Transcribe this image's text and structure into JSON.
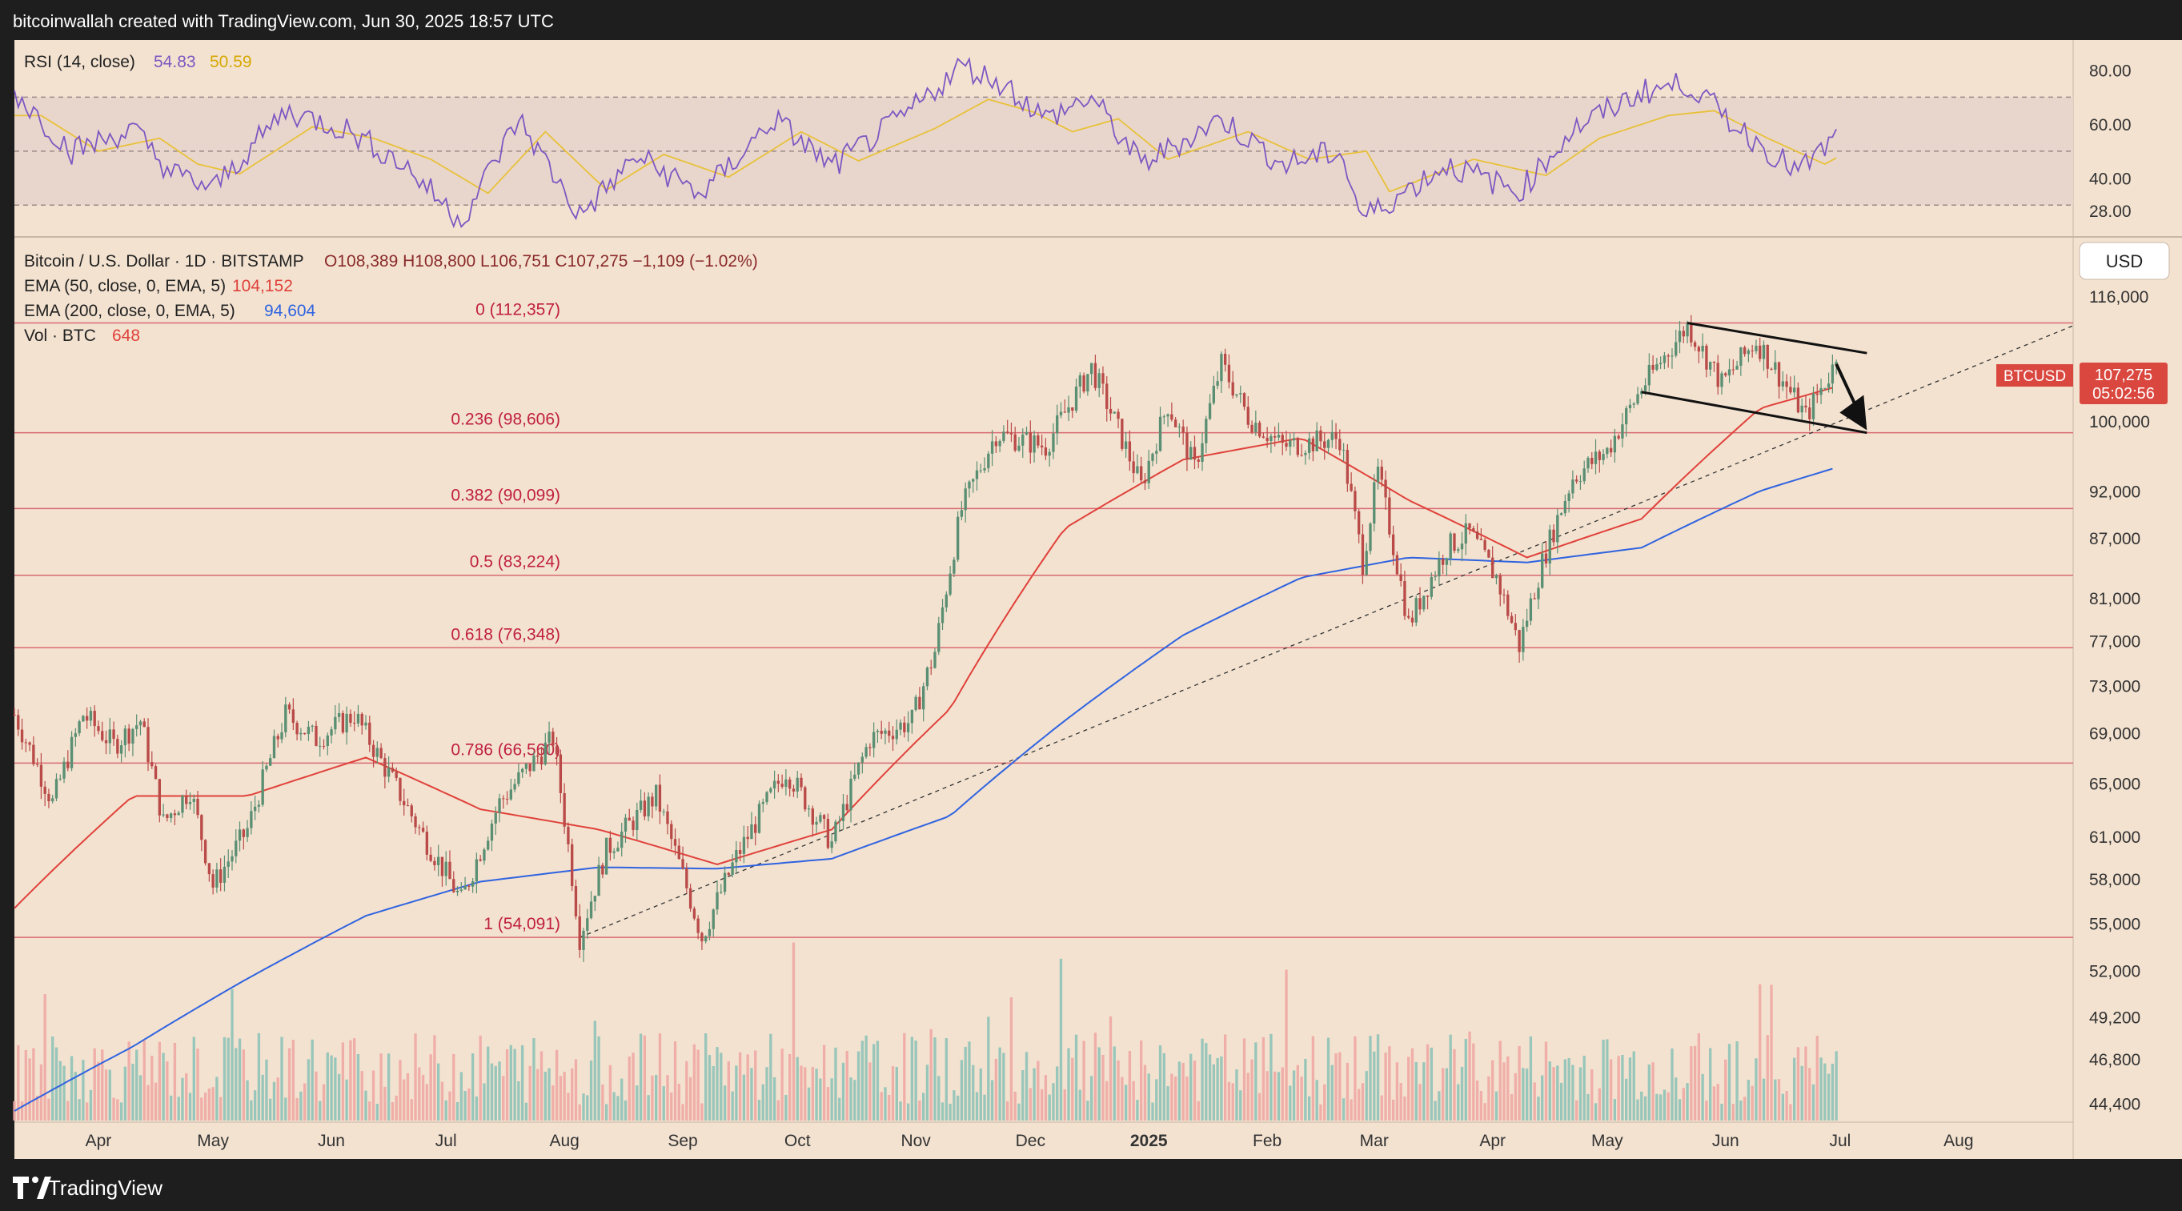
{
  "header": {
    "attribution": "bitcoinwallah created with TradingView.com, Jun 30, 2025 18:57 UTC"
  },
  "footer": {
    "brand": "TradingView"
  },
  "colors": {
    "page_bg": "#1e1e1e",
    "panel_bg": "#f3e2d0",
    "rsi_band": "#e8d6cc",
    "up_candle": "#5a8f73",
    "down_candle": "#b94a48",
    "rsi_line": "#7e57c2",
    "rsi_ma": "#e8c13a",
    "ema50": "#e0413a",
    "ema200": "#2f63e0",
    "fib_line": "#d96a72",
    "fib_text": "#c02040",
    "vol_up": "#8fc3b7",
    "vol_down": "#f0a8a3",
    "price_tag": "#d9473f"
  },
  "rsi_panel": {
    "title": "RSI (14, close)",
    "value": "54.83",
    "ma_value": "50.59",
    "ticks": [
      "80.00",
      "60.00",
      "40.00",
      "28.00"
    ]
  },
  "legend": {
    "symbol": "Bitcoin / U.S. Dollar · 1D · BITSTAMP",
    "ohlc": "O108,389  H108,800  L106,751  C107,275  −1,109 (−1.02%)",
    "ema50_label": "EMA (50, close, 0, EMA, 5)",
    "ema50_value": "104,152",
    "ema200_label": "EMA (200, close, 0, EMA, 5)",
    "ema200_value": "94,604",
    "vol_label": "Vol · BTC",
    "vol_value": "648"
  },
  "currency_button": "USD",
  "price_tag": {
    "symbol": "BTCUSD",
    "price": "107,275",
    "countdown": "05:02:56"
  },
  "price_axis_ticks": [
    {
      "label": "116,000",
      "value": 116000
    },
    {
      "label": "100,000",
      "value": 100000
    },
    {
      "label": "92,000",
      "value": 92000
    },
    {
      "label": "87,000",
      "value": 87000
    },
    {
      "label": "81,000",
      "value": 81000
    },
    {
      "label": "77,000",
      "value": 77000
    },
    {
      "label": "73,000",
      "value": 73000
    },
    {
      "label": "69,000",
      "value": 69000
    },
    {
      "label": "65,000",
      "value": 65000
    },
    {
      "label": "61,000",
      "value": 61000
    },
    {
      "label": "58,000",
      "value": 58000
    },
    {
      "label": "55,000",
      "value": 55000
    },
    {
      "label": "52,000",
      "value": 52000
    },
    {
      "label": "49,200",
      "value": 49200
    },
    {
      "label": "46,800",
      "value": 46800
    },
    {
      "label": "44,400",
      "value": 44400
    }
  ],
  "time_axis": [
    {
      "label": "Apr",
      "date": "2024-04-01",
      "bold": false
    },
    {
      "label": "May",
      "date": "2024-05-01",
      "bold": false
    },
    {
      "label": "Jun",
      "date": "2024-06-01",
      "bold": false
    },
    {
      "label": "Jul",
      "date": "2024-07-01",
      "bold": false
    },
    {
      "label": "Aug",
      "date": "2024-08-01",
      "bold": false
    },
    {
      "label": "Sep",
      "date": "2024-09-01",
      "bold": false
    },
    {
      "label": "Oct",
      "date": "2024-10-01",
      "bold": false
    },
    {
      "label": "Nov",
      "date": "2024-11-01",
      "bold": false
    },
    {
      "label": "Dec",
      "date": "2024-12-01",
      "bold": false
    },
    {
      "label": "2025",
      "date": "2025-01-01",
      "bold": true
    },
    {
      "label": "Feb",
      "date": "2025-02-01",
      "bold": false
    },
    {
      "label": "Mar",
      "date": "2025-03-01",
      "bold": false
    },
    {
      "label": "Apr",
      "date": "2025-04-01",
      "bold": false
    },
    {
      "label": "May",
      "date": "2025-05-01",
      "bold": false
    },
    {
      "label": "Jun",
      "date": "2025-06-01",
      "bold": false
    },
    {
      "label": "Jul",
      "date": "2025-07-01",
      "bold": false
    },
    {
      "label": "Aug",
      "date": "2025-08-01",
      "bold": false
    }
  ],
  "chart_data": {
    "type": "line",
    "title": "Bitcoin / U.S. Dollar · 1D · BITSTAMP",
    "y_scale": "log",
    "ylim": [
      43500,
      124000
    ],
    "x_range": [
      "2024-03-10",
      "2025-08-31"
    ],
    "grid": false,
    "fib_levels": [
      {
        "label": "0 (112,357)",
        "value": 112357
      },
      {
        "label": "0.236 (98,606)",
        "value": 98606
      },
      {
        "label": "0.382 (90,099)",
        "value": 90099
      },
      {
        "label": "0.5 (83,224)",
        "value": 83224
      },
      {
        "label": "0.618 (76,348)",
        "value": 76348
      },
      {
        "label": "0.786 (66,560)",
        "value": 66560
      },
      {
        "label": "1 (54,091)",
        "value": 54091
      }
    ],
    "series": [
      {
        "name": "Bitcoin / U.S. Dollar",
        "points": [
          [
            "2024-03-10",
            70500
          ],
          [
            "2024-03-20",
            63500
          ],
          [
            "2024-03-28",
            70500
          ],
          [
            "2024-04-05",
            68000
          ],
          [
            "2024-04-12",
            70000
          ],
          [
            "2024-04-18",
            62000
          ],
          [
            "2024-04-25",
            64500
          ],
          [
            "2024-05-01",
            57500
          ],
          [
            "2024-05-10",
            61500
          ],
          [
            "2024-05-20",
            70500
          ],
          [
            "2024-05-28",
            68500
          ],
          [
            "2024-06-07",
            70500
          ],
          [
            "2024-06-15",
            66200
          ],
          [
            "2024-06-24",
            61500
          ],
          [
            "2024-07-05",
            56500
          ],
          [
            "2024-07-15",
            63500
          ],
          [
            "2024-07-29",
            68500
          ],
          [
            "2024-08-05",
            54091
          ],
          [
            "2024-08-12",
            60000
          ],
          [
            "2024-08-25",
            64000
          ],
          [
            "2024-09-06",
            54100
          ],
          [
            "2024-09-15",
            59500
          ],
          [
            "2024-09-28",
            66000
          ],
          [
            "2024-10-10",
            60500
          ],
          [
            "2024-10-20",
            68500
          ],
          [
            "2024-10-31",
            70000
          ],
          [
            "2024-11-06",
            76000
          ],
          [
            "2024-11-13",
            90000
          ],
          [
            "2024-11-22",
            98500
          ],
          [
            "2024-12-05",
            97000
          ],
          [
            "2024-12-17",
            106500
          ],
          [
            "2024-12-30",
            92500
          ],
          [
            "2025-01-06",
            102000
          ],
          [
            "2025-01-13",
            94500
          ],
          [
            "2025-01-20",
            107000
          ],
          [
            "2025-01-27",
            100500
          ],
          [
            "2025-02-05",
            97000
          ],
          [
            "2025-02-20",
            98000
          ],
          [
            "2025-02-26",
            84500
          ],
          [
            "2025-03-02",
            94000
          ],
          [
            "2025-03-10",
            78500
          ],
          [
            "2025-03-20",
            86000
          ],
          [
            "2025-03-26",
            87500
          ],
          [
            "2025-04-02",
            83000
          ],
          [
            "2025-04-08",
            76500
          ],
          [
            "2025-04-14",
            84500
          ],
          [
            "2025-04-22",
            93500
          ],
          [
            "2025-05-01",
            96500
          ],
          [
            "2025-05-10",
            104000
          ],
          [
            "2025-05-22",
            112000
          ],
          [
            "2025-05-31",
            104500
          ],
          [
            "2025-06-09",
            110000
          ],
          [
            "2025-06-22",
            100500
          ],
          [
            "2025-06-30",
            107275
          ]
        ]
      },
      {
        "name": "EMA (50, close, 0, EMA, 5)",
        "points": [
          [
            "2024-03-10",
            56000
          ],
          [
            "2024-04-10",
            64000
          ],
          [
            "2024-05-10",
            64000
          ],
          [
            "2024-06-10",
            67000
          ],
          [
            "2024-07-10",
            63000
          ],
          [
            "2024-08-10",
            61500
          ],
          [
            "2024-09-10",
            59000
          ],
          [
            "2024-10-10",
            61500
          ],
          [
            "2024-11-10",
            71000
          ],
          [
            "2024-12-10",
            88000
          ],
          [
            "2025-01-10",
            95500
          ],
          [
            "2025-02-10",
            98000
          ],
          [
            "2025-03-10",
            91000
          ],
          [
            "2025-04-10",
            85000
          ],
          [
            "2025-05-10",
            89000
          ],
          [
            "2025-06-10",
            101500
          ],
          [
            "2025-06-30",
            104152
          ]
        ]
      },
      {
        "name": "EMA (200, close, 0, EMA, 5)",
        "points": [
          [
            "2024-03-10",
            44000
          ],
          [
            "2024-04-10",
            47500
          ],
          [
            "2024-05-10",
            51500
          ],
          [
            "2024-06-10",
            55500
          ],
          [
            "2024-07-10",
            57800
          ],
          [
            "2024-08-10",
            58800
          ],
          [
            "2024-09-10",
            58700
          ],
          [
            "2024-10-10",
            59400
          ],
          [
            "2024-11-10",
            62500
          ],
          [
            "2024-12-10",
            70000
          ],
          [
            "2025-01-10",
            77500
          ],
          [
            "2025-02-10",
            83000
          ],
          [
            "2025-03-10",
            85000
          ],
          [
            "2025-04-10",
            84500
          ],
          [
            "2025-05-10",
            86000
          ],
          [
            "2025-06-10",
            92000
          ],
          [
            "2025-06-30",
            94604
          ]
        ]
      }
    ],
    "rsi": {
      "ylim": [
        20,
        90
      ],
      "band": [
        30,
        70
      ],
      "points": [
        [
          "2024-03-10",
          72
        ],
        [
          "2024-03-25",
          50
        ],
        [
          "2024-04-10",
          58
        ],
        [
          "2024-04-20",
          42
        ],
        [
          "2024-05-01",
          36
        ],
        [
          "2024-05-20",
          65
        ],
        [
          "2024-06-05",
          58
        ],
        [
          "2024-06-20",
          45
        ],
        [
          "2024-07-05",
          24
        ],
        [
          "2024-07-20",
          62
        ],
        [
          "2024-08-05",
          26
        ],
        [
          "2024-08-20",
          48
        ],
        [
          "2024-09-06",
          34
        ],
        [
          "2024-09-25",
          62
        ],
        [
          "2024-10-10",
          44
        ],
        [
          "2024-10-30",
          64
        ],
        [
          "2024-11-13",
          82
        ],
        [
          "2024-11-25",
          74
        ],
        [
          "2024-12-05",
          62
        ],
        [
          "2024-12-17",
          70
        ],
        [
          "2024-12-30",
          45
        ],
        [
          "2025-01-20",
          62
        ],
        [
          "2025-02-05",
          45
        ],
        [
          "2025-02-20",
          50
        ],
        [
          "2025-02-26",
          25
        ],
        [
          "2025-03-20",
          45
        ],
        [
          "2025-04-08",
          35
        ],
        [
          "2025-04-22",
          58
        ],
        [
          "2025-05-10",
          72
        ],
        [
          "2025-05-22",
          75
        ],
        [
          "2025-06-05",
          58
        ],
        [
          "2025-06-20",
          42
        ],
        [
          "2025-06-30",
          54.83
        ]
      ]
    }
  }
}
